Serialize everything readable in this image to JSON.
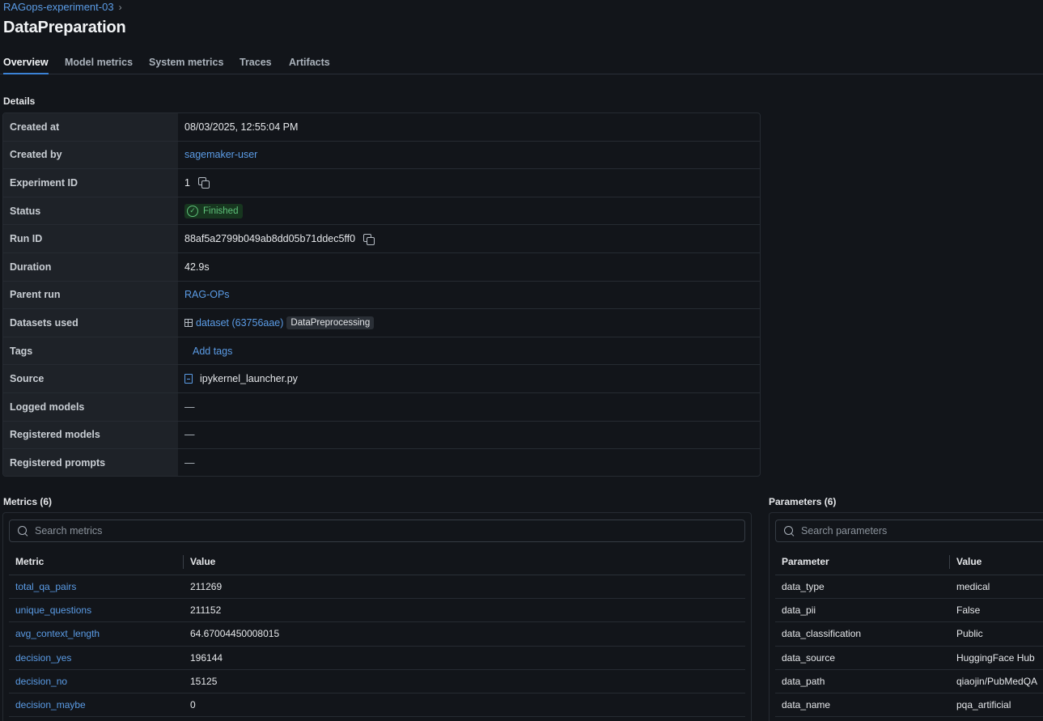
{
  "breadcrumb": {
    "experiment": "RAGops-experiment-03",
    "separator": "›"
  },
  "page_title": "DataPreparation",
  "tabs": [
    {
      "label": "Overview"
    },
    {
      "label": "Model metrics"
    },
    {
      "label": "System metrics"
    },
    {
      "label": "Traces"
    },
    {
      "label": "Artifacts"
    }
  ],
  "details": {
    "title": "Details",
    "created_at": {
      "label": "Created at",
      "value": "08/03/2025, 12:55:04 PM"
    },
    "created_by": {
      "label": "Created by",
      "value": "sagemaker-user"
    },
    "experiment_id": {
      "label": "Experiment ID",
      "value": "1"
    },
    "status": {
      "label": "Status",
      "value": "Finished"
    },
    "run_id": {
      "label": "Run ID",
      "value": "88af5a2799b049ab8dd05b71ddec5ff0"
    },
    "duration": {
      "label": "Duration",
      "value": "42.9s"
    },
    "parent_run": {
      "label": "Parent run",
      "value": "RAG-OPs"
    },
    "datasets_used": {
      "label": "Datasets used",
      "dataset": "dataset (63756aae)",
      "tag": "DataPreprocessing"
    },
    "tags": {
      "label": "Tags",
      "action": "Add tags"
    },
    "source": {
      "label": "Source",
      "value": "ipykernel_launcher.py"
    },
    "logged_models": {
      "label": "Logged models",
      "value": "—"
    },
    "registered_models": {
      "label": "Registered models",
      "value": "—"
    },
    "registered_prompts": {
      "label": "Registered prompts",
      "value": "—"
    }
  },
  "metrics": {
    "title": "Metrics (6)",
    "search_placeholder": "Search metrics",
    "columns": [
      "Metric",
      "Value"
    ],
    "rows": [
      {
        "name": "total_qa_pairs",
        "value": "211269"
      },
      {
        "name": "unique_questions",
        "value": "211152"
      },
      {
        "name": "avg_context_length",
        "value": "64.67004450008015"
      },
      {
        "name": "decision_yes",
        "value": "196144"
      },
      {
        "name": "decision_no",
        "value": "15125"
      },
      {
        "name": "decision_maybe",
        "value": "0"
      }
    ]
  },
  "parameters": {
    "title": "Parameters (6)",
    "search_placeholder": "Search parameters",
    "columns": [
      "Parameter",
      "Value"
    ],
    "rows": [
      {
        "name": "data_type",
        "value": "medical"
      },
      {
        "name": "data_pii",
        "value": "False"
      },
      {
        "name": "data_classification",
        "value": "Public"
      },
      {
        "name": "data_source",
        "value": "HuggingFace Hub"
      },
      {
        "name": "data_path",
        "value": "qiaojin/PubMedQA"
      },
      {
        "name": "data_name",
        "value": "pqa_artificial"
      }
    ]
  },
  "colors": {
    "background": "#12151a",
    "link": "#5b9ce6",
    "accent": "#3b82d6",
    "success": "#5ec27a"
  }
}
